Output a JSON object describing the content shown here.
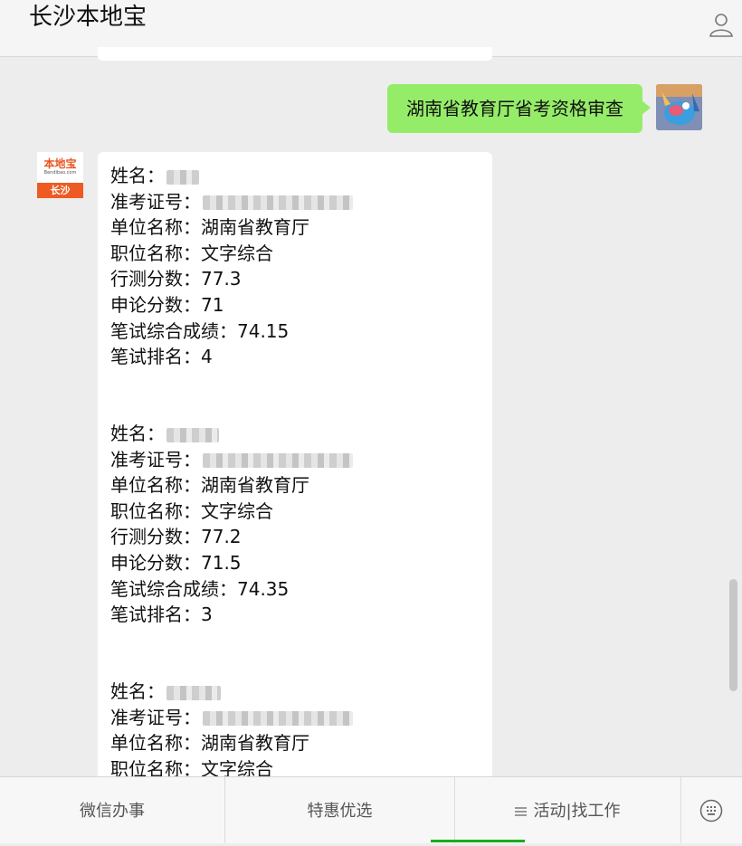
{
  "header": {
    "title": "长沙本地宝"
  },
  "outgoing": {
    "text": "湖南省教育厅省考资格审查"
  },
  "account_avatar": {
    "logo": "本地宝",
    "sub": "Bendibao.com",
    "city": "长沙"
  },
  "records": [
    {
      "lines": [
        {
          "label": "姓名：",
          "value": ""
        },
        {
          "label": "准考证号：",
          "value": ""
        },
        {
          "label": "单位名称：",
          "value": "湖南省教育厅"
        },
        {
          "label": "职位名称：",
          "value": "文字综合"
        },
        {
          "label": "行测分数：",
          "value": "77.3"
        },
        {
          "label": "申论分数：",
          "value": "71"
        },
        {
          "label": "笔试综合成绩：",
          "value": "74.15"
        },
        {
          "label": "笔试排名：",
          "value": "4"
        }
      ]
    },
    {
      "lines": [
        {
          "label": "姓名：",
          "value": ""
        },
        {
          "label": "准考证号：",
          "value": ""
        },
        {
          "label": "单位名称：",
          "value": "湖南省教育厅"
        },
        {
          "label": "职位名称：",
          "value": "文字综合"
        },
        {
          "label": "行测分数：",
          "value": "77.2"
        },
        {
          "label": "申论分数：",
          "value": "71.5"
        },
        {
          "label": "笔试综合成绩：",
          "value": "74.35"
        },
        {
          "label": "笔试排名：",
          "value": "3"
        }
      ]
    },
    {
      "lines": [
        {
          "label": "姓名：",
          "value": ""
        },
        {
          "label": "准考证号：",
          "value": ""
        },
        {
          "label": "单位名称：",
          "value": "湖南省教育厅"
        },
        {
          "label": "职位名称：",
          "value": "文字综合"
        }
      ]
    }
  ],
  "bottom_menu": {
    "item1": "微信办事",
    "item2": "特惠优选",
    "item3": "活动|找工作"
  },
  "icons": {
    "header": "user-profile-icon",
    "menu3": "menu-list-icon",
    "input_toggle": "keyboard-icon"
  }
}
